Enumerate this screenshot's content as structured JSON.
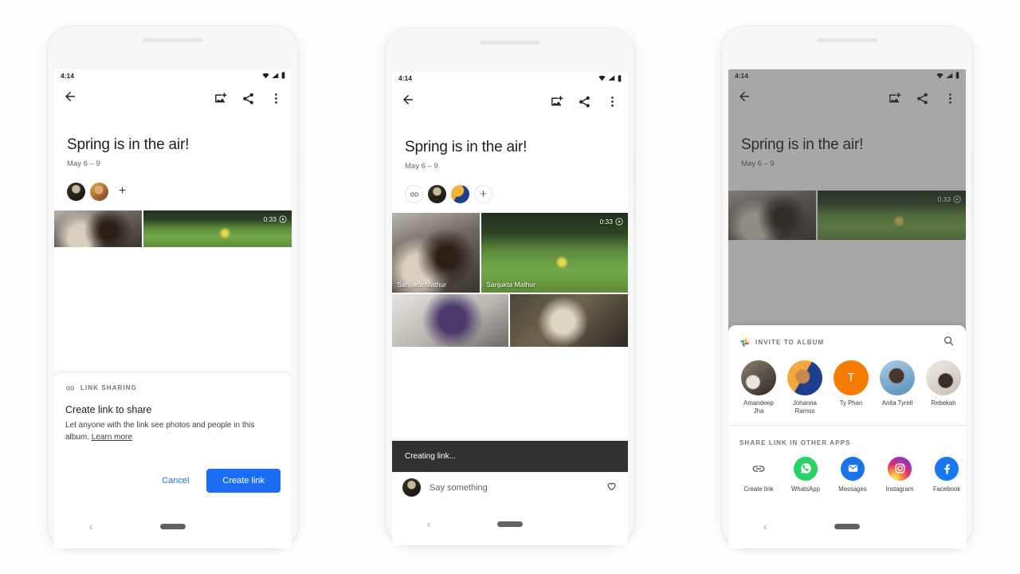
{
  "status_bar": {
    "time": "4:14",
    "icons": [
      "wifi-icon",
      "cell-signal-icon",
      "battery-icon"
    ]
  },
  "app_bar": {
    "back": "back-arrow-icon",
    "add_photos": "add-photos-icon",
    "share": "share-icon",
    "overflow": "more-vert-icon"
  },
  "album": {
    "title": "Spring is in the air!",
    "dates": "May 6 – 9"
  },
  "media": {
    "video_duration": "0:33",
    "attribution": "Sanjukta Mathur",
    "items": [
      {
        "name": "photo-kitchen",
        "attrib": "Sanjukta Mathur"
      },
      {
        "name": "photo-lawn-video",
        "attrib": "Sanjukta Mathur",
        "duration": "0:33"
      },
      {
        "name": "photo-purple-hood"
      },
      {
        "name": "photo-sun-hat"
      }
    ]
  },
  "phone1": {
    "sheet": {
      "eyebrow": "LINK SHARING",
      "eyebrow_icon": "link-icon",
      "heading": "Create link to share",
      "body": "Let anyone with the link see photos and people in this album.",
      "learn_more": "Learn more",
      "cancel_label": "Cancel",
      "create_label": "Create link"
    }
  },
  "phone2": {
    "link_chip_icon": "link-icon",
    "add_person_icon": "plus-icon",
    "snackbar": "Creating link...",
    "comment_placeholder": "Say something",
    "favorite_icon": "heart-outline-icon"
  },
  "phone3": {
    "invite": {
      "eyebrow": "INVITE TO ALBUM",
      "logo": "google-photos-logo",
      "search_icon": "search-icon",
      "contacts": [
        {
          "name": "Amandeep Jha",
          "type": "photo",
          "avatar": "avatar-amandeep"
        },
        {
          "name": "Johanna Ramos",
          "type": "photo",
          "avatar": "avatar-johanna"
        },
        {
          "name": "Ty Phan",
          "type": "initial",
          "initial": "T",
          "color": "#f57c00"
        },
        {
          "name": "Anita Tyrell",
          "type": "photo",
          "avatar": "avatar-anita"
        },
        {
          "name": "Rebekah",
          "type": "photo",
          "avatar": "avatar-rebekah"
        }
      ]
    },
    "share_apps": {
      "eyebrow": "SHARE LINK IN OTHER APPS",
      "items": [
        {
          "label": "Create link",
          "icon": "link-icon",
          "color": "#ffffff"
        },
        {
          "label": "WhatsApp",
          "icon": "whatsapp-icon",
          "color": "#25d366"
        },
        {
          "label": "Messages",
          "icon": "messages-icon",
          "color": "#1a73e8"
        },
        {
          "label": "Instagram",
          "icon": "instagram-icon",
          "color": "#e1306c"
        },
        {
          "label": "Facebook",
          "icon": "facebook-icon",
          "color": "#1877f2"
        }
      ]
    }
  },
  "nav_bar": {
    "back_icon": "chevron-left-icon",
    "home_pill": "home-gesture-pill"
  },
  "colors": {
    "accent_blue": "#1b6ef3",
    "link_blue": "#1a73e8",
    "snackbar_bg": "#323232",
    "scrim": "rgba(60,60,60,0.45)"
  }
}
